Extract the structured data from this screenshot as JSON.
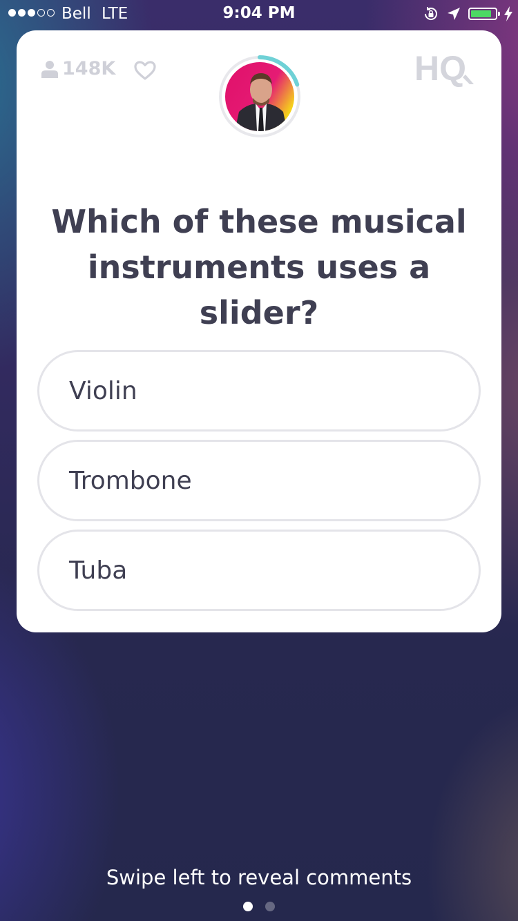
{
  "status_bar": {
    "carrier": "Bell",
    "network": "LTE",
    "time": "9:04 PM",
    "signal_bars_filled": 3,
    "signal_bars_total": 5,
    "battery_level": 0.85,
    "battery_color": "#4cd964",
    "icons": [
      "orientation-lock-icon",
      "location-arrow-icon",
      "battery-icon",
      "charging-bolt-icon"
    ]
  },
  "game": {
    "viewer_count": "148K",
    "logo": "HQ",
    "timer_progress": 0.2,
    "timer_color": "#6fd1d6",
    "question": "Which of these musical instruments uses a slider?",
    "answers": [
      {
        "label": "Violin"
      },
      {
        "label": "Trombone"
      },
      {
        "label": "Tuba"
      }
    ]
  },
  "footer": {
    "hint": "Swipe left to reveal comments",
    "pages_total": 2,
    "active_page": 1
  }
}
